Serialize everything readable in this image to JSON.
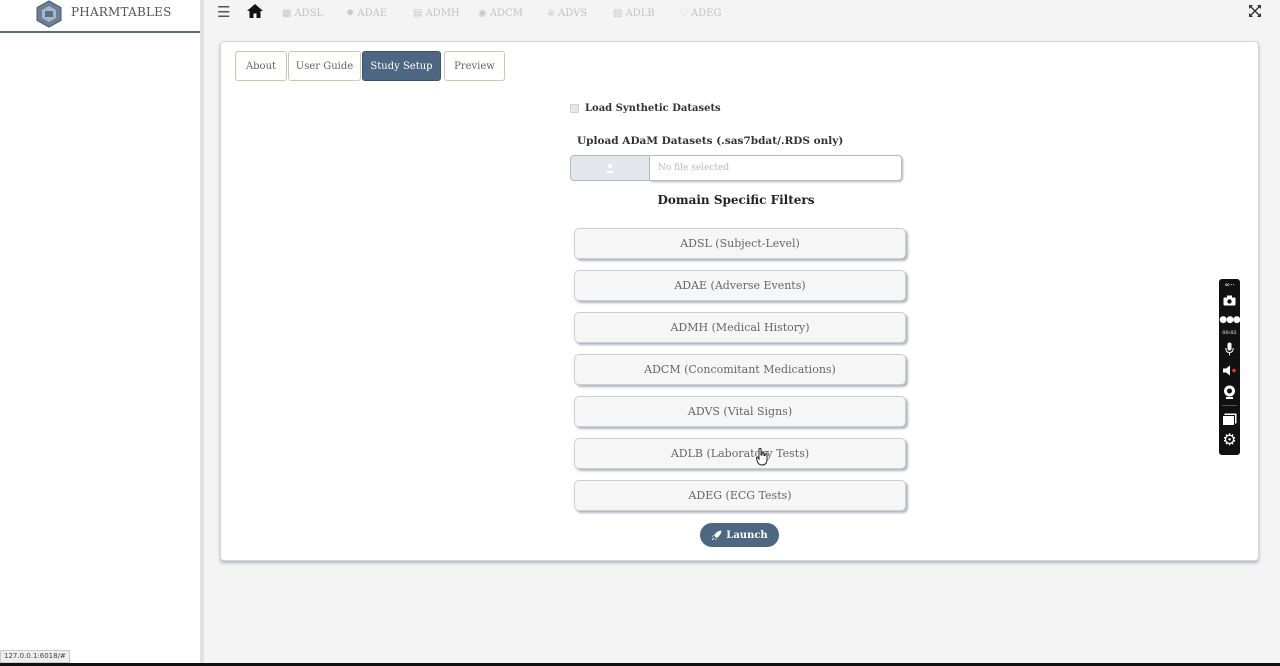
{
  "brand": {
    "name": "PHARMTABLES"
  },
  "nav": {
    "items": [
      {
        "label": "ADSL",
        "icon": "table-icon"
      },
      {
        "label": "ADAE",
        "icon": "virus-icon"
      },
      {
        "label": "ADMH",
        "icon": "document-icon"
      },
      {
        "label": "ADCM",
        "icon": "pills-icon"
      },
      {
        "label": "ADVS",
        "icon": "stethoscope-icon"
      },
      {
        "label": "ADLB",
        "icon": "flask-icon"
      },
      {
        "label": "ADEG",
        "icon": "heartbeat-icon"
      }
    ]
  },
  "tabs": [
    {
      "label": "About",
      "active": false
    },
    {
      "label": "User Guide",
      "active": false
    },
    {
      "label": "Study Setup",
      "active": true
    },
    {
      "label": "Preview",
      "active": false
    }
  ],
  "setup": {
    "synthetic_label": "Load Synthetic Datasets",
    "upload_label": "Upload ADaM Datasets (.sas7bdat/.RDS only)",
    "file_placeholder": "No file selected",
    "filters_title": "Domain Specific Filters",
    "filters": [
      "ADSL (Subject-Level)",
      "ADAE (Adverse Events)",
      "ADMH (Medical History)",
      "ADCM (Concomitant Medications)",
      "ADVS (Vital Signs)",
      "ADLB (Laboratory Tests)",
      "ADEG (ECG Tests)"
    ],
    "launch_label": "Launch"
  },
  "recorder": {
    "timer": "00:02"
  },
  "status": {
    "url": "127.0.0.1:6018/#"
  },
  "colors": {
    "accent": "#4d6682",
    "sidebar_border": "#5a6b82"
  }
}
